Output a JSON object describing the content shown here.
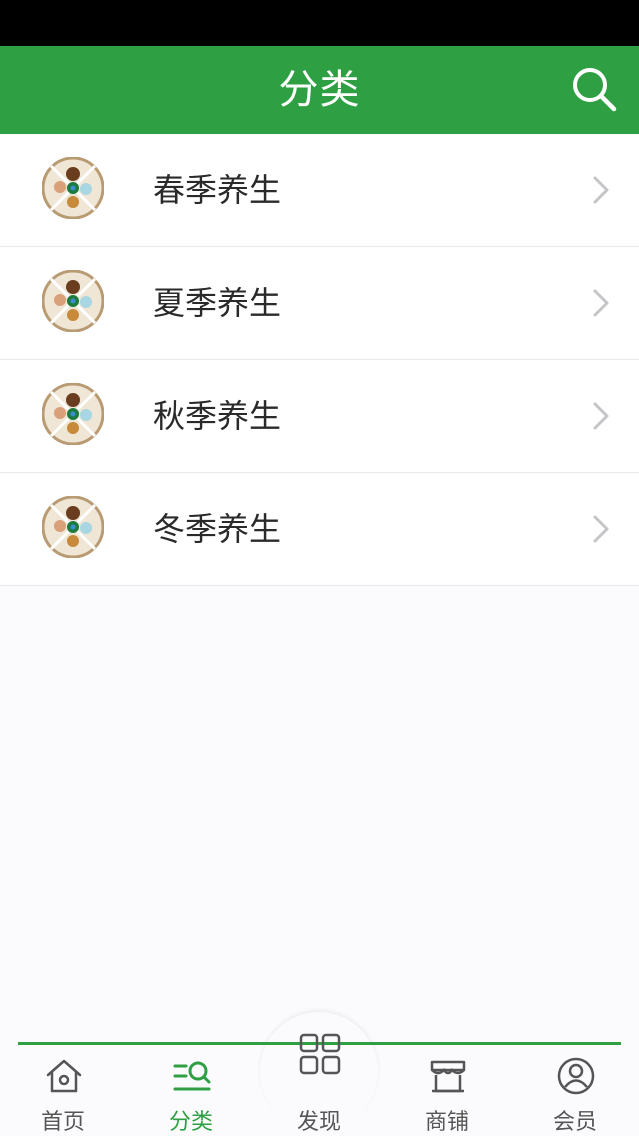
{
  "header": {
    "title": "分类",
    "search_icon": "search-icon"
  },
  "categories": [
    {
      "label": "春季养生",
      "icon": "category-thumbnail-icon"
    },
    {
      "label": "夏季养生",
      "icon": "category-thumbnail-icon"
    },
    {
      "label": "秋季养生",
      "icon": "category-thumbnail-icon"
    },
    {
      "label": "冬季养生",
      "icon": "category-thumbnail-icon"
    }
  ],
  "tabs": [
    {
      "label": "首页",
      "icon": "home-icon",
      "active": false
    },
    {
      "label": "分类",
      "icon": "category-icon",
      "active": true
    },
    {
      "label": "发现",
      "icon": "grid-icon",
      "active": false
    },
    {
      "label": "商铺",
      "icon": "store-icon",
      "active": false
    },
    {
      "label": "会员",
      "icon": "user-icon",
      "active": false
    }
  ],
  "colors": {
    "primary_green": "#2ea043",
    "status_bar": "#000000",
    "background": "#fbfafd",
    "text": "#2a2a2a",
    "tab_inactive": "#555555"
  }
}
